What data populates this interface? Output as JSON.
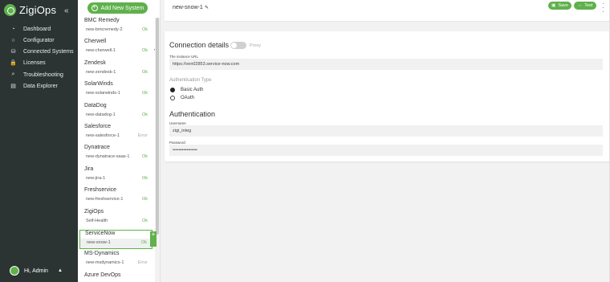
{
  "brand": {
    "name": "ZigiOps"
  },
  "nav": {
    "items": [
      {
        "label": "Dashboard",
        "icon": "dashboard-icon",
        "glyph": "◔"
      },
      {
        "label": "Configurator",
        "icon": "configurator-icon",
        "glyph": "○"
      },
      {
        "label": "Connected Systems",
        "icon": "connected-systems-icon",
        "glyph": "⛁"
      },
      {
        "label": "Licenses",
        "icon": "lock-icon",
        "glyph": "🔒"
      },
      {
        "label": "Troubleshooting",
        "icon": "search-icon",
        "glyph": "⌕"
      },
      {
        "label": "Data Explorer",
        "icon": "data-explorer-icon",
        "glyph": "▤"
      }
    ],
    "user_label": "Hi, Admin"
  },
  "systems": {
    "add_label": "Add New System",
    "items": [
      {
        "name": "BMC Remedy",
        "instance": "new-bmcremedy-2",
        "status": "Ok"
      },
      {
        "name": "Cherwell",
        "instance": "new-cherwell-1",
        "status": "Ok"
      },
      {
        "name": "Zendesk",
        "instance": "new-zendesk-1",
        "status": "Ok"
      },
      {
        "name": "SolarWinds",
        "instance": "new-solarwinds-1",
        "status": "Ok"
      },
      {
        "name": "DataDog",
        "instance": "new-datadog-1",
        "status": "Ok"
      },
      {
        "name": "Salesforce",
        "instance": "new-salesforce-1",
        "status": "Error"
      },
      {
        "name": "Dynatrace",
        "instance": "new-dynatrace-saas-1",
        "status": "Ok"
      },
      {
        "name": "Jira",
        "instance": "new-jira-1",
        "status": "Ok"
      },
      {
        "name": "Freshservice",
        "instance": "new-freshservice-1",
        "status": "Ok"
      },
      {
        "name": "ZigiOps",
        "instance": "Self-Health",
        "status": "Ok"
      },
      {
        "name": "ServiceNow",
        "instance": "new-snow-1",
        "status": "Ok"
      },
      {
        "name": "MS-Dynamics",
        "instance": "new-msdynamics-1",
        "status": "Error"
      },
      {
        "name": "Azure DevOps",
        "instance": "",
        "status": ""
      }
    ],
    "selected_index": 10
  },
  "header": {
    "title": "new-snow-1",
    "save_label": "Save",
    "test_label": "Test"
  },
  "connection": {
    "heading": "Connection details",
    "proxy_label": "Proxy",
    "url_label": "The instance URL",
    "url_value": "https://ven02853.service-now.com",
    "auth_type_label": "Authentication Type",
    "auth_options": [
      "Basic Auth",
      "OAuth"
    ],
    "auth_selected": "Basic Auth",
    "auth_heading": "Authentication",
    "username_label": "Username",
    "username_value": "zigi_integ",
    "password_label": "Password",
    "password_value": "••••••••••••••••"
  },
  "colors": {
    "accent": "#5fb14c",
    "nav_bg": "#2b3433",
    "error": "#a8a8a8"
  }
}
